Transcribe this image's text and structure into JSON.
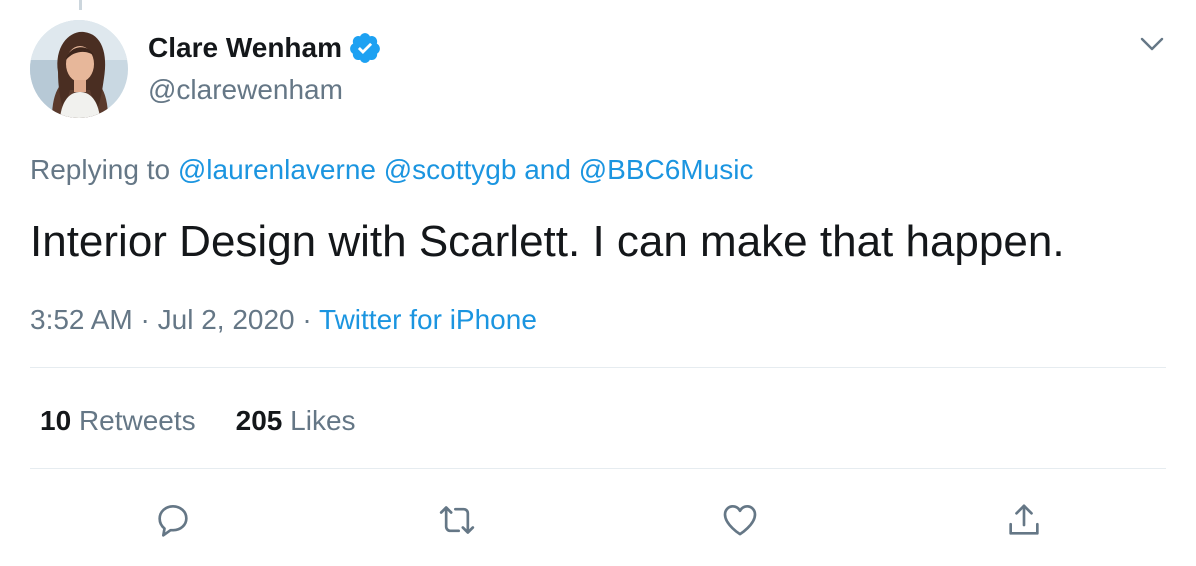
{
  "tweet": {
    "author": {
      "display_name": "Clare Wenham",
      "handle": "@clarewenham",
      "verified": true
    },
    "replying_to": {
      "prefix": "Replying to",
      "mentions": [
        "@laurenlaverne",
        "@scottygb",
        "@BBC6Music"
      ],
      "conjunction": "and"
    },
    "text": "Interior Design with Scarlett. I can make that happen.",
    "meta": {
      "time": "3:52 AM",
      "date": "Jul 2, 2020",
      "separator": "·",
      "source": "Twitter for iPhone"
    },
    "stats": {
      "retweets_count": "10",
      "retweets_label": "Retweets",
      "likes_count": "205",
      "likes_label": "Likes"
    }
  },
  "icons": {
    "caret": "chevron-down-icon",
    "verified": "verified-badge-icon",
    "reply": "reply-icon",
    "retweet": "retweet-icon",
    "like": "heart-icon",
    "share": "share-icon"
  },
  "colors": {
    "link": "#1b95e0",
    "secondary_text": "#657786",
    "primary_text": "#14171a",
    "verified": "#1da1f2",
    "divider": "#e6ecf0"
  }
}
